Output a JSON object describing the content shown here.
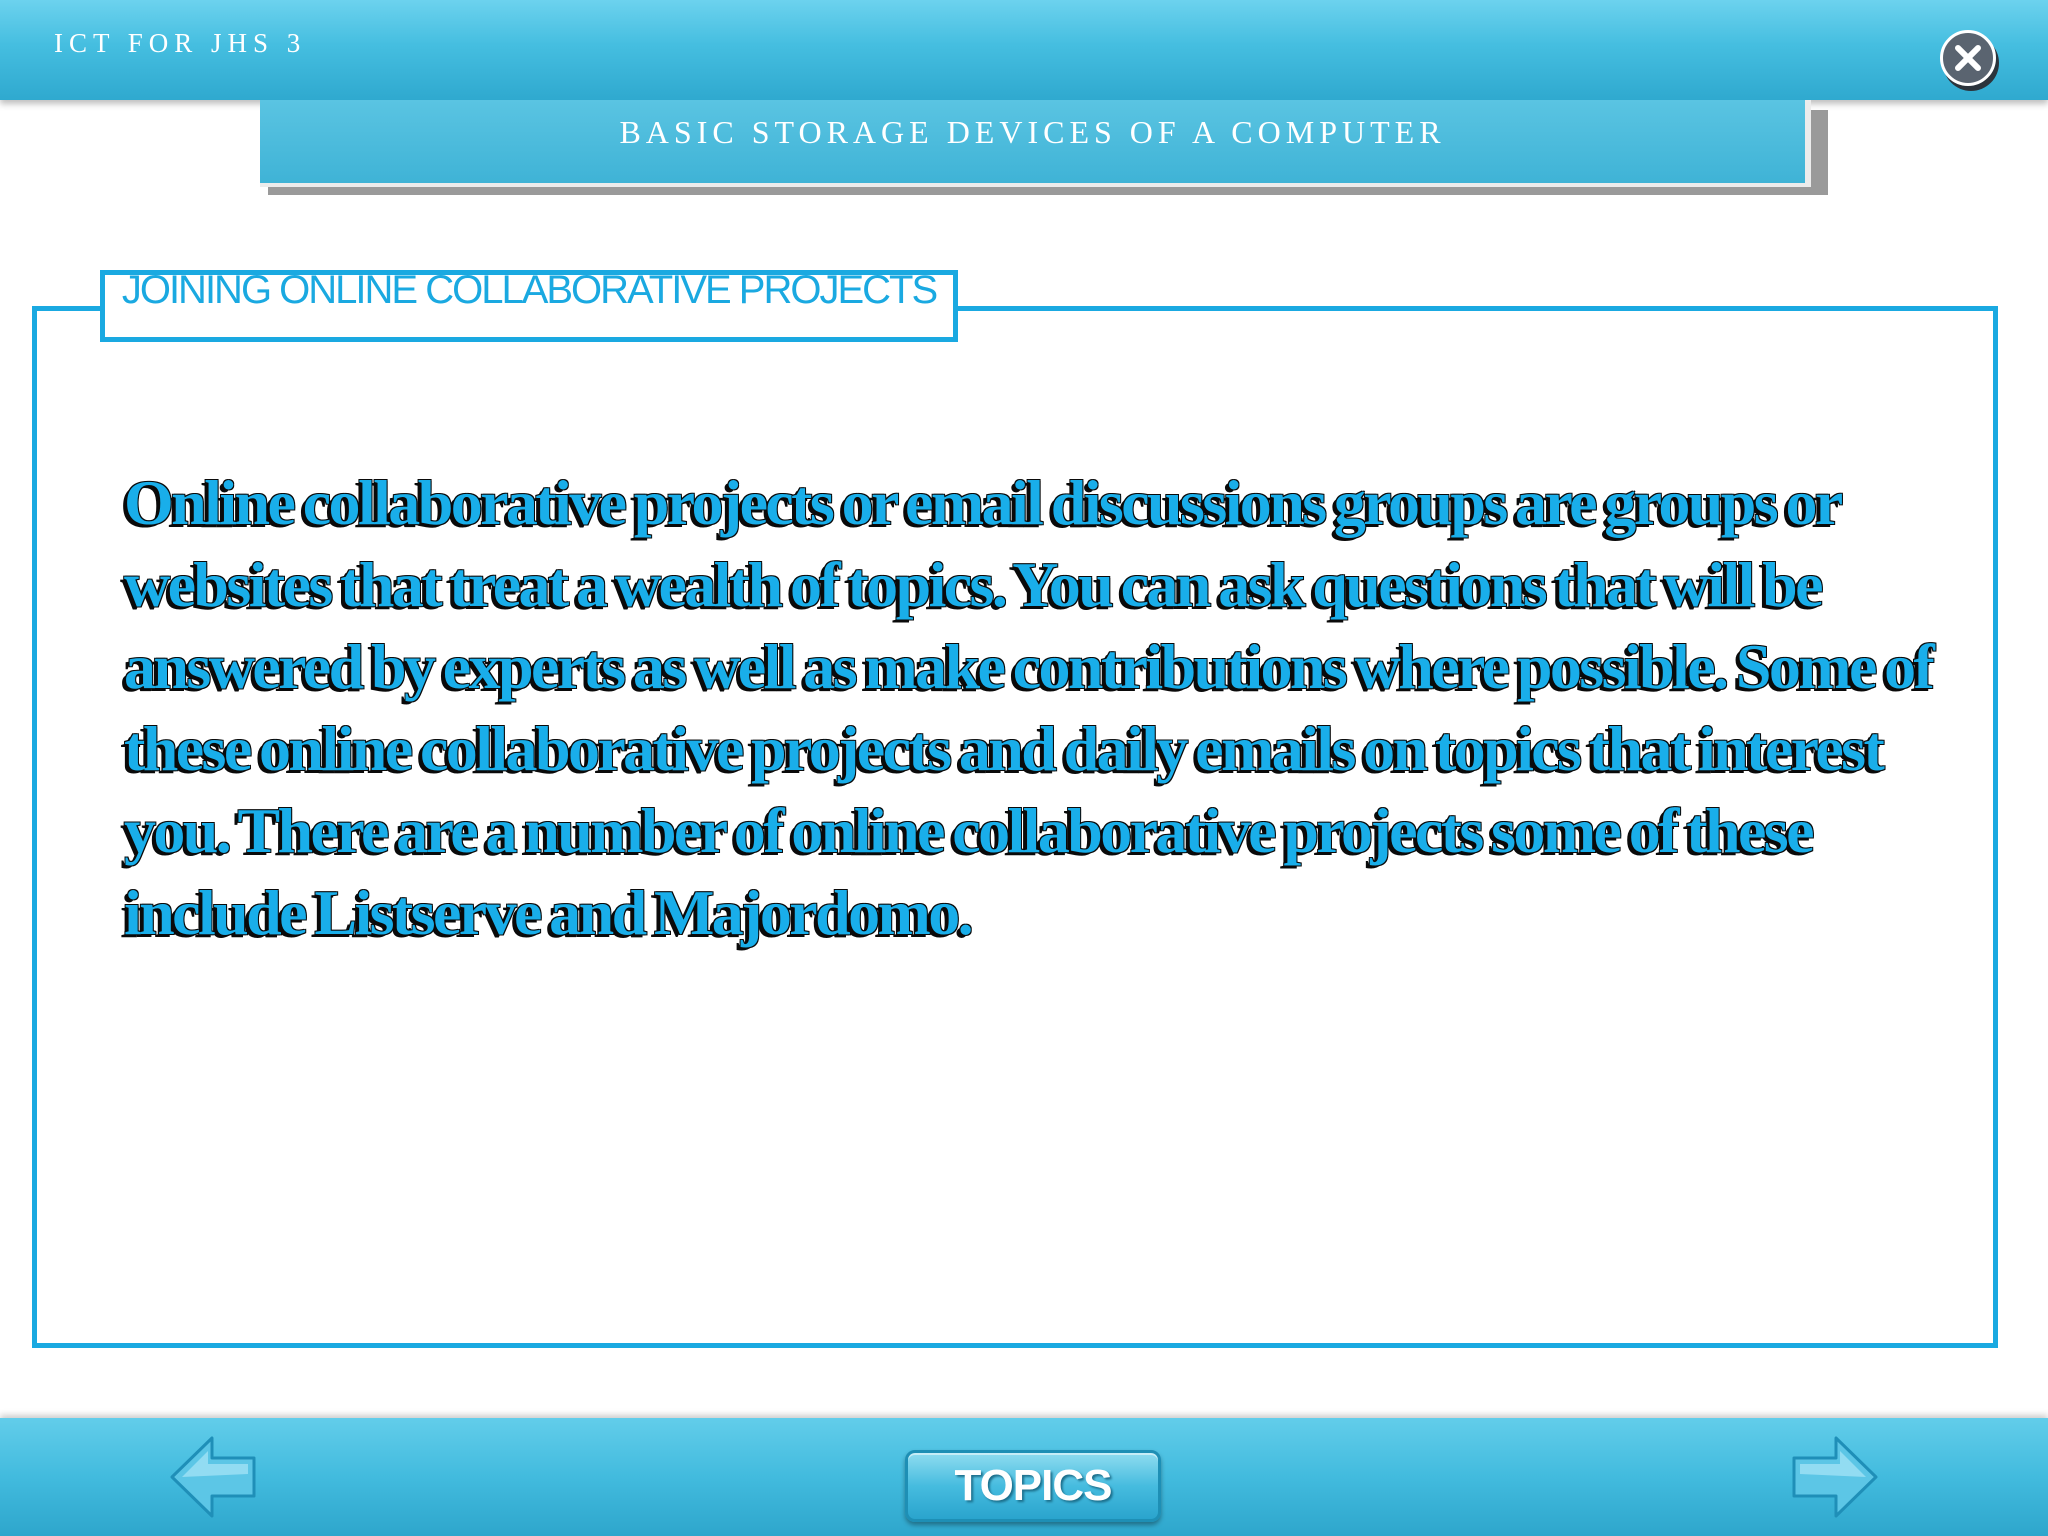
{
  "header": {
    "app_title": "ICT FOR JHS 3",
    "close_icon": "close-circle-icon"
  },
  "banner": {
    "section_title": "BASIC STORAGE DEVICES OF A  COMPUTER"
  },
  "content": {
    "topic_label": "JOINING ONLINE COLLABORATIVE PROJECTS",
    "body_text": "Online collaborative projects or email discussions groups are groups or websites that treat a wealth of topics. You can ask questions that will be answered by experts as well as make contributions where possible. Some of these online collaborative projects and daily emails on topics that interest you. There are a number of online collaborative projects some of these include Listserve and Majordomo."
  },
  "footer": {
    "prev_icon": "arrow-left-icon",
    "next_icon": "arrow-right-icon",
    "topics_label": "TOPICS"
  },
  "colors": {
    "bar_blue": "#45bee0",
    "accent_blue": "#1aa9e1",
    "text_blue": "#19aeea"
  }
}
